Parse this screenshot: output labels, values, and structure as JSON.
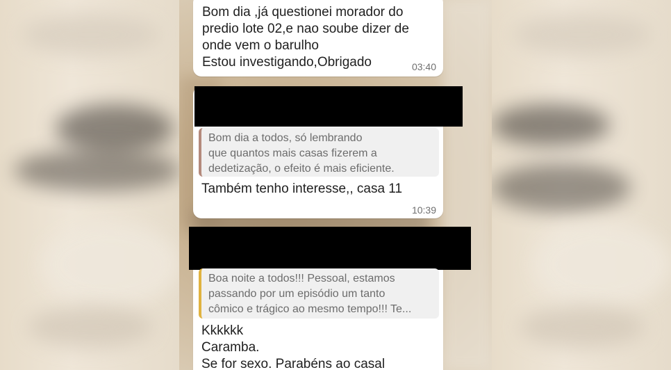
{
  "messages": [
    {
      "text": "Bom dia ,já questionei morador do\npredio lote 02,e nao soube dizer de\nonde vem o barulho\nEstou investigando,Obrigado",
      "time": "03:40"
    },
    {
      "sender_redacted": true,
      "quote": "Bom dia a todos, só lembrando\nque quantos mais casas fizerem a\ndedetização, o efeito é mais eficiente.",
      "text": "Também tenho interesse,, casa 11",
      "time": "10:39"
    },
    {
      "sender_redacted": true,
      "quote": "Boa noite a todos!!! Pessoal, estamos\npassando por um episódio um tanto\ncômico e trágico ao mesmo tempo!!! Te...",
      "text": "Kkkkkk\nCaramba.\nSe for sexo. Parabéns ao casal"
    }
  ],
  "colors": {
    "bubble": "#ffffff",
    "quote_bar_1": "#b48a7c",
    "quote_bar_2": "#e0b340",
    "redaction": "#000000"
  }
}
